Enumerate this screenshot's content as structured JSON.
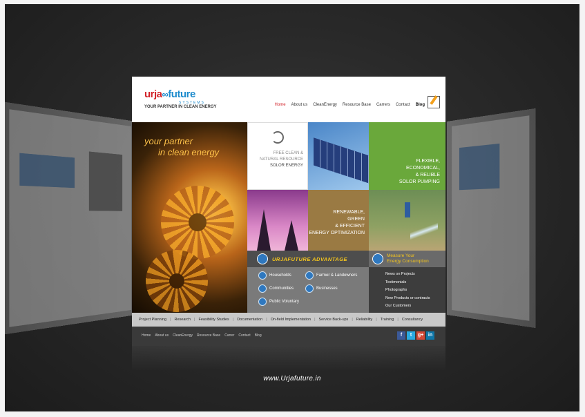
{
  "logo": {
    "word1": "urja",
    "ring": "∞",
    "word2": "future",
    "systems": "SYSTEMS",
    "tagline": "YOUR PARTNER IN CLEAN ENERGY"
  },
  "nav": {
    "items": [
      "Home",
      "About us",
      "CleanEnergy",
      "Resource Base",
      "Carrers",
      "Contact",
      "Blog"
    ]
  },
  "hero": {
    "line1": "your partner",
    "line2": "in clean energy"
  },
  "tiles": {
    "solar": [
      "FREE CLEAN &",
      "NATURAL RESOURCE",
      "SOLOR ENERGY"
    ],
    "pumping": [
      "FLEXIBLE,",
      "ECONOMICAL,",
      "& RELIBLE",
      "SOLOR PUMPING"
    ],
    "optimization": [
      "RENEWABLE,",
      "GREEN",
      "& EFFICIENT",
      "ENERGY OPTIMIZATION"
    ]
  },
  "advantage": {
    "title": "URJAFUTURE ADVANTAGE",
    "items": [
      "Households",
      "Farmer & Landowners",
      "Communities",
      "Businesses",
      "Public Voluntary"
    ]
  },
  "measure": {
    "title": [
      "Measure Your",
      "Energy Consumption"
    ],
    "links": [
      "News on Projects",
      "Testimonials",
      "Photographs",
      "New Products or contracts",
      "Our Customers"
    ]
  },
  "services": [
    "Project Planning",
    "Research",
    "Feasibility Studies",
    "Documentation",
    "On-field Implementation",
    "Service Back-ups",
    "Reliability",
    "Training",
    "Consultancy"
  ],
  "footer": {
    "links": [
      "Home",
      "About us",
      "CleanEnergy",
      "Resource Base",
      "Carrer",
      "Contact",
      "Blog"
    ],
    "social": [
      "f",
      "t",
      "g+",
      "in"
    ]
  },
  "url": "www.Urjafuture.in",
  "colors": {
    "brand_red": "#d2232a",
    "brand_blue": "#1f8ccd",
    "accent_yellow": "#f3c41e",
    "green_tile": "#6aa83b"
  }
}
